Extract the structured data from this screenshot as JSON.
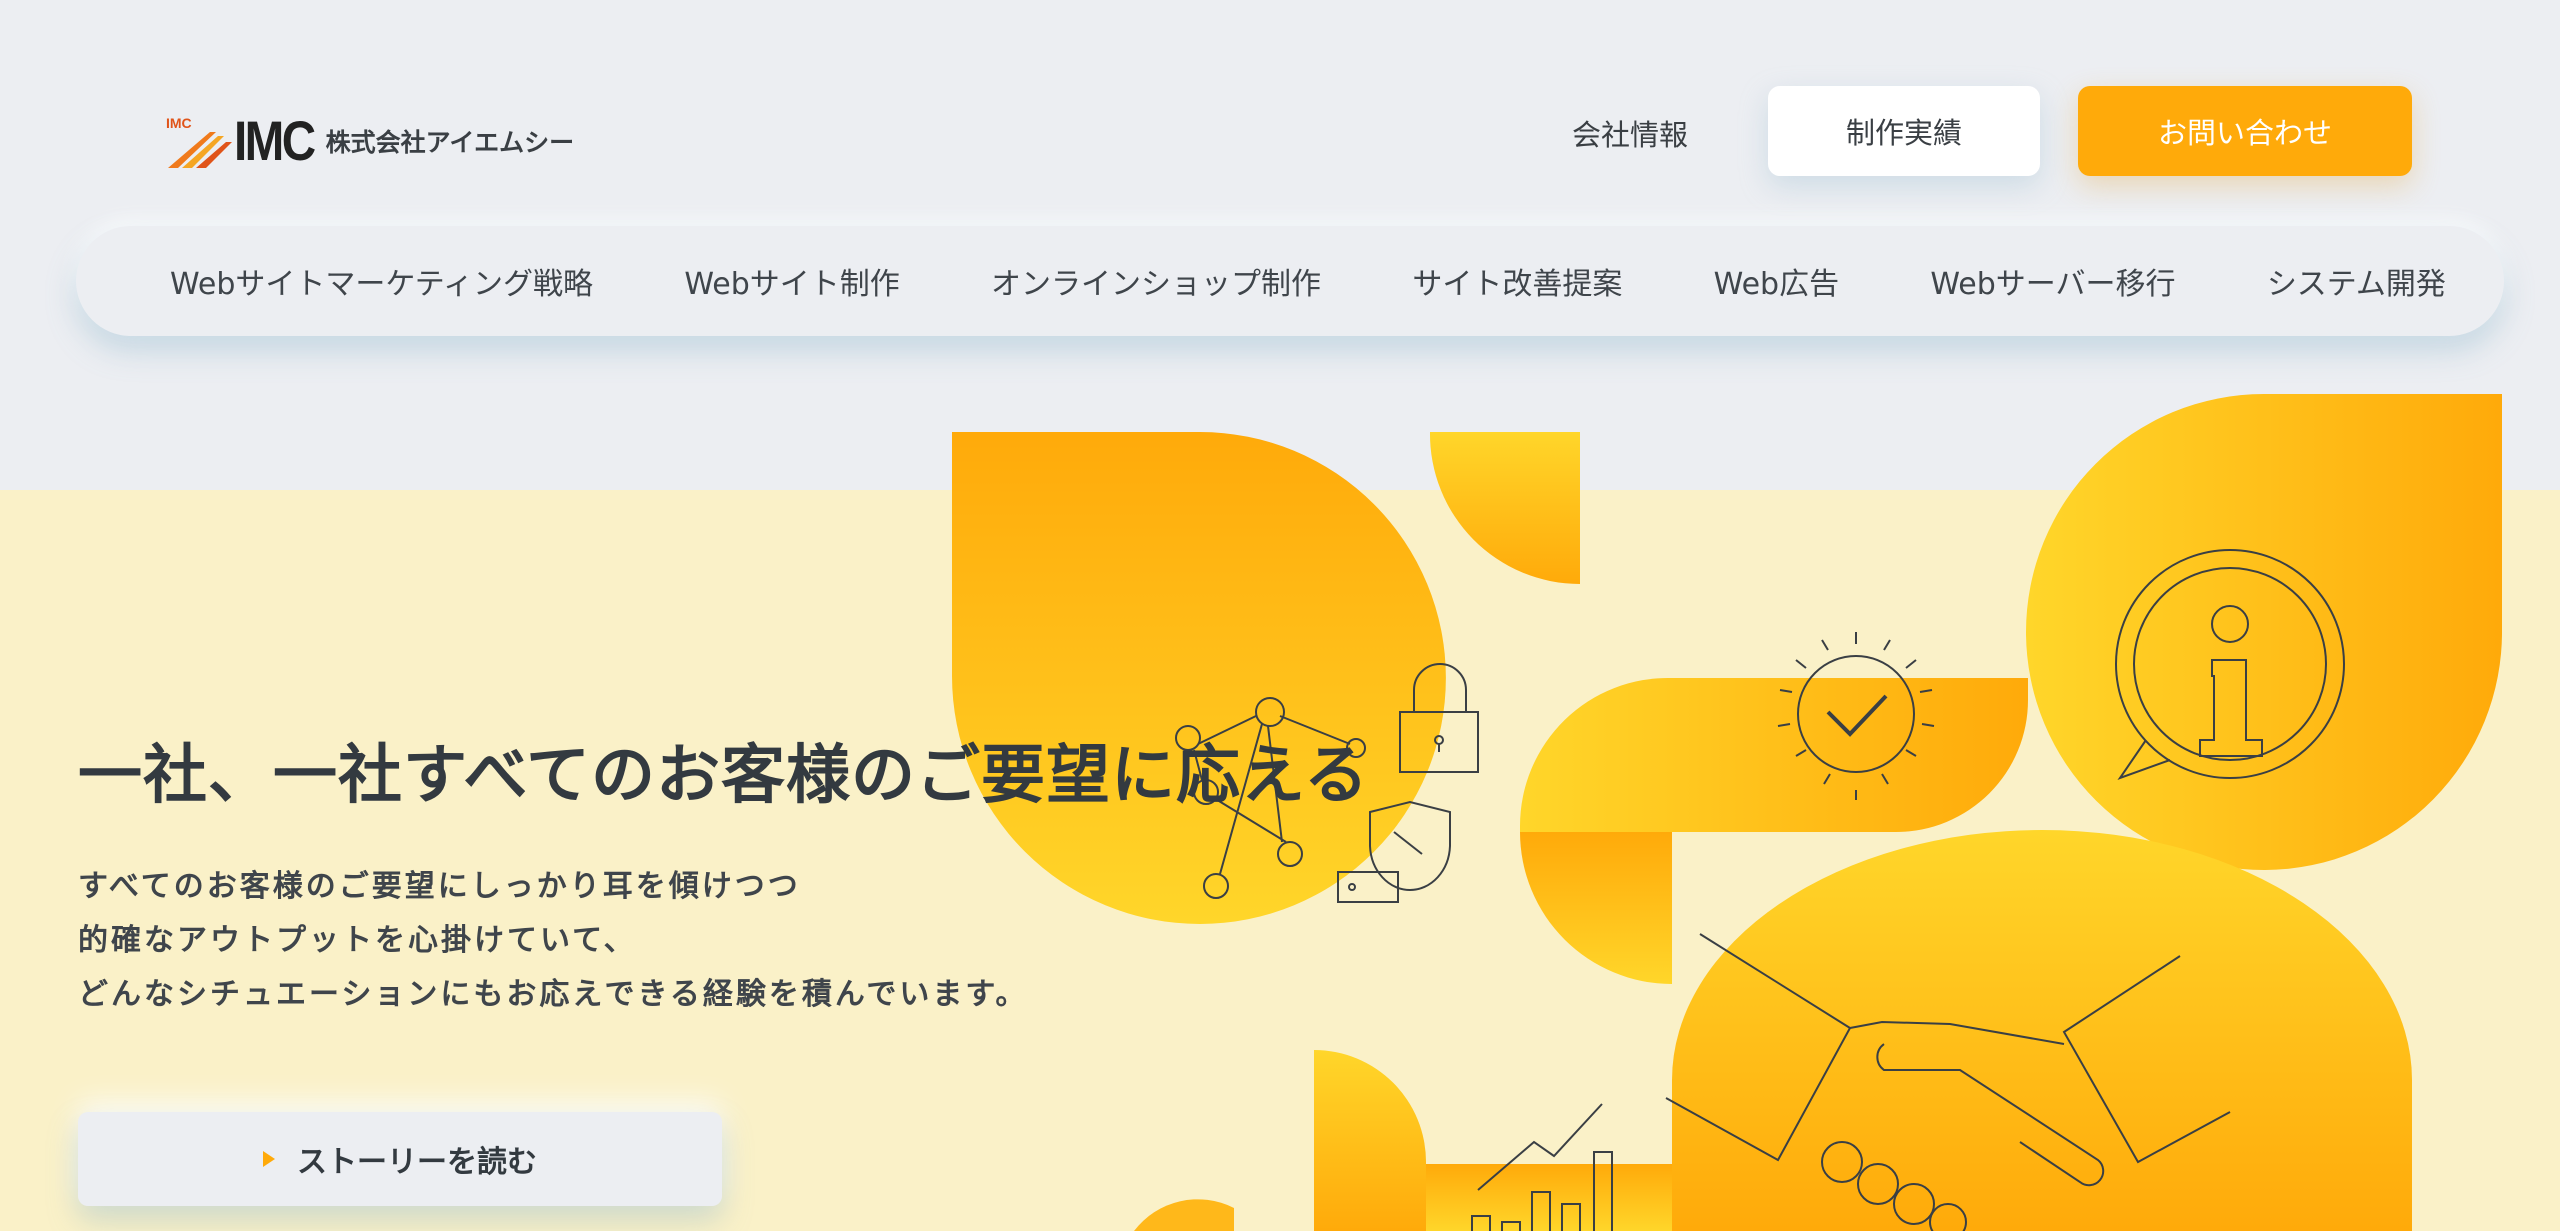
{
  "header": {
    "logo_badge": "IMC",
    "logo_text": "IMC",
    "company_name": "株式会社アイエムシー",
    "company_link": "会社情報",
    "works_button": "制作実績",
    "contact_button": "お問い合わせ"
  },
  "nav": {
    "items": [
      {
        "label": "Webサイトマーケティング戦略"
      },
      {
        "label": "Webサイト制作"
      },
      {
        "label": "オンラインショップ制作"
      },
      {
        "label": "サイト改善提案"
      },
      {
        "label": "Web広告"
      },
      {
        "label": "Webサーバー移行"
      },
      {
        "label": "システム開発"
      }
    ]
  },
  "hero": {
    "title": "一社、一社すべてのお客様のご要望に応える",
    "lead": [
      "すべてのお客様のご要望にしっかり耳を傾けつつ",
      "的確なアウトプットを心掛けていて、",
      "どんなシチュエーションにもお応えできる経験を積んでいます。"
    ],
    "cta": "ストーリーを読む"
  },
  "icons": [
    "network-icon",
    "lock-icon",
    "shield-icon",
    "check-badge-icon",
    "info-icon",
    "handshake-icon",
    "growth-chart-icon"
  ],
  "colors": {
    "accent": "#ffaa0a",
    "accent_light": "#ffd62a",
    "hero_background": "#faf1c8",
    "page_background": "#eceef2"
  }
}
